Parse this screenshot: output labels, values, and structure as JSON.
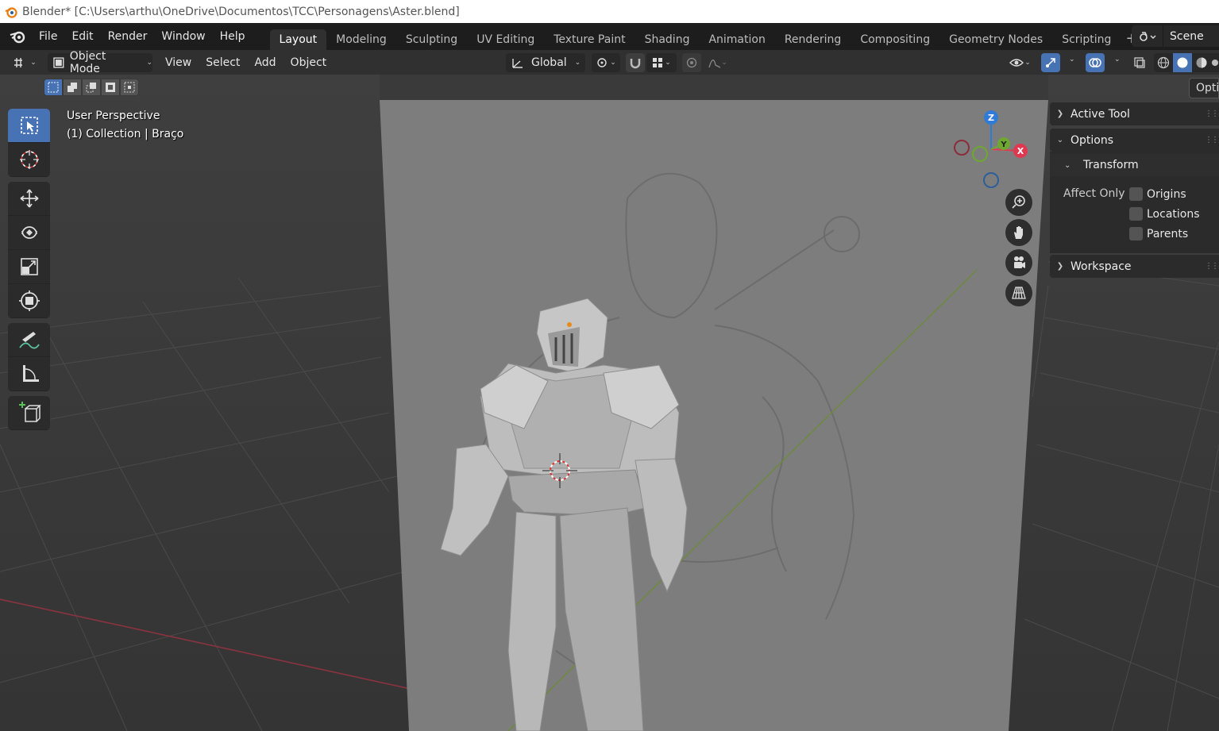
{
  "window": {
    "title": "Blender* [C:\\Users\\arthu\\OneDrive\\Documentos\\TCC\\Personagens\\Aster.blend]"
  },
  "menus": [
    "File",
    "Edit",
    "Render",
    "Window",
    "Help"
  ],
  "workspaces": [
    {
      "label": "Layout",
      "active": true
    },
    {
      "label": "Modeling"
    },
    {
      "label": "Sculpting"
    },
    {
      "label": "UV Editing"
    },
    {
      "label": "Texture Paint"
    },
    {
      "label": "Shading"
    },
    {
      "label": "Animation"
    },
    {
      "label": "Rendering"
    },
    {
      "label": "Compositing"
    },
    {
      "label": "Geometry Nodes"
    },
    {
      "label": "Scripting"
    }
  ],
  "scene": {
    "name": "Scene"
  },
  "header": {
    "mode": "Object Mode",
    "view_menus": [
      "View",
      "Select",
      "Add",
      "Object"
    ],
    "orientation": "Global"
  },
  "viewport": {
    "perspective": "User Perspective",
    "collection": "(1) Collection | Braço",
    "gizmo_axes": {
      "z": "Z",
      "y": "Y",
      "x": "X"
    }
  },
  "sidebar": {
    "tab": "Options",
    "active_tool": "Active Tool",
    "options": "Options",
    "transform": "Transform",
    "affect_only": "Affect Only",
    "checkboxes": [
      "Origins",
      "Locations",
      "Parents"
    ],
    "workspace": "Workspace"
  },
  "colors": {
    "accent": "#4772b3",
    "x_axis": "#e0394f",
    "y_axis": "#6ea830",
    "z_axis": "#2f7bd6"
  }
}
